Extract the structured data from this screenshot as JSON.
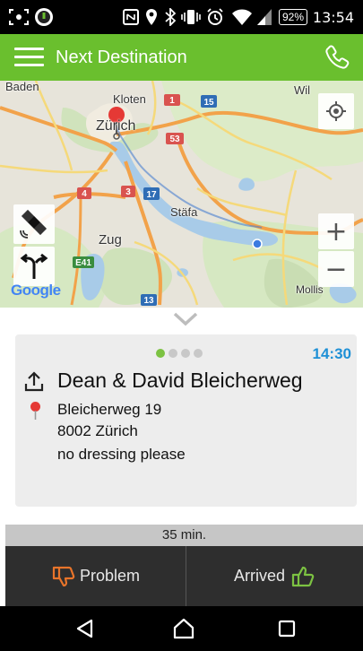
{
  "status_bar": {
    "battery": "92%",
    "time": "13:54",
    "icons": [
      "screenshot-icon",
      "app-icon",
      "nfc-icon",
      "location-icon",
      "bluetooth-icon",
      "vibrate-icon",
      "alarm-icon",
      "wifi-icon",
      "signal-icon",
      "battery-icon"
    ]
  },
  "app_bar": {
    "title": "Next Destination",
    "menu_icon": "menu-icon",
    "call_icon": "phone-icon",
    "color": "#6abf2e"
  },
  "map": {
    "labels": {
      "baden": "Baden",
      "kloten": "Kloten",
      "zurich": "Zürich",
      "wil": "Wil",
      "stafa": "Stäfa",
      "zug": "Zug",
      "mollis": "Mollis"
    },
    "road_shields": [
      "1",
      "15",
      "53",
      "4",
      "3",
      "17",
      "E41",
      "13"
    ],
    "zoom_in": "+",
    "zoom_out": "−",
    "attribution": "Google"
  },
  "card": {
    "eta": "14:30",
    "name": "Dean & David Bleicherweg",
    "street": "Bleicherweg 19",
    "city": "8002 Zürich",
    "note": "no dressing please",
    "pager": {
      "count": 4,
      "active": 1
    },
    "eta_color": "#1e90d6"
  },
  "duration": "35 min.",
  "actions": {
    "problem": "Problem",
    "arrived": "Arrived",
    "problem_color": "#e8742a",
    "arrived_color": "#7cc242"
  }
}
